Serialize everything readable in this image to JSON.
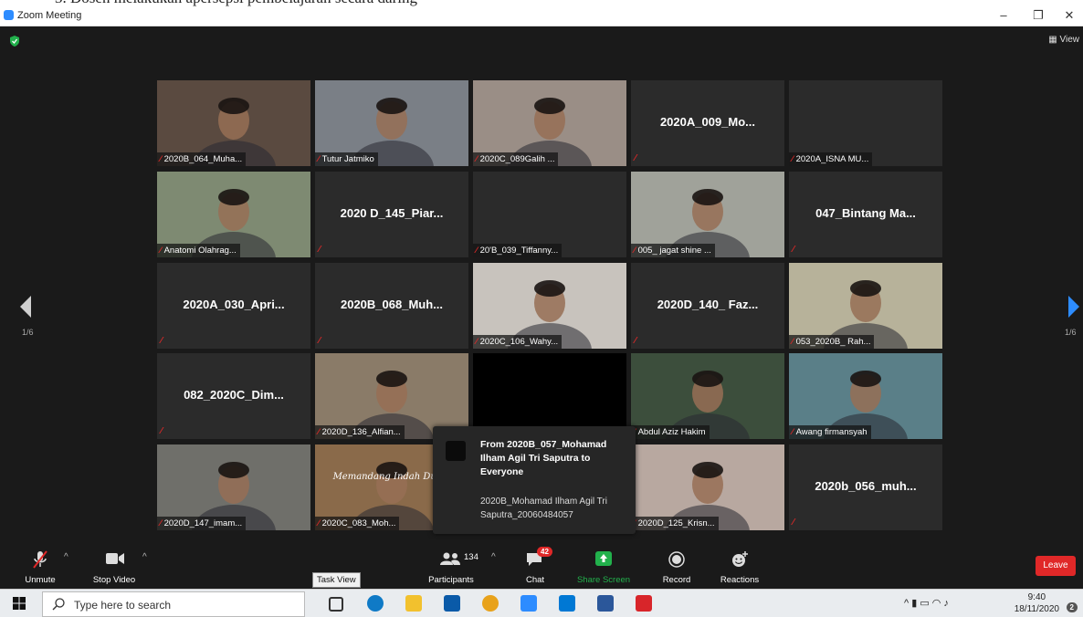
{
  "document_fragment": "3.   Dosen melakukan apersepsi pembelajaran secara daring",
  "window": {
    "title": "Zoom Meeting",
    "minimize": "–",
    "maximize": "❐",
    "close": "✕"
  },
  "view_label": "View",
  "page_indicator": {
    "left": "1/6",
    "right": "1/6"
  },
  "tiles": [
    {
      "name": "2020B_064_Muha...",
      "video": true,
      "bg": "#5a4a40"
    },
    {
      "name": "Tutur Jatmiko",
      "video": true,
      "bg": "#7a7f86"
    },
    {
      "name": "2020C_089Galih ...",
      "video": true,
      "bg": "#9a8e86"
    },
    {
      "name": "2020A_009_Mo...",
      "video": false
    },
    {
      "name": "2020A_ISNA MU...",
      "video": true,
      "bg": "#2b2b2b"
    },
    {
      "name": "Anatomi Olahrag...",
      "video": true,
      "bg": "#7e8a72"
    },
    {
      "name": "2020 D_145_Piar...",
      "video": false
    },
    {
      "name": "20'B_039_Tiffanny...",
      "video": true,
      "bg": "#2b2b2b"
    },
    {
      "name": "005_ jagat shine ...",
      "video": true,
      "bg": "#a0a29a"
    },
    {
      "name": "047_Bintang Ma...",
      "video": false
    },
    {
      "name": "2020A_030_Apri...",
      "video": false
    },
    {
      "name": "2020B_068_Muh...",
      "video": false
    },
    {
      "name": "2020C_106_Wahy...",
      "video": true,
      "bg": "#c8c3bd"
    },
    {
      "name": "2020D_140_ Faz...",
      "video": false
    },
    {
      "name": "053_2020B_ Rah...",
      "video": true,
      "bg": "#b7b29a"
    },
    {
      "name": "082_2020C_Dim...",
      "video": false
    },
    {
      "name": "2020D_136_Alfian...",
      "video": true,
      "bg": "#8a7b68"
    },
    {
      "name": "",
      "video": true,
      "bg": "#000000"
    },
    {
      "name": "Abdul Aziz Hakim",
      "video": true,
      "bg": "#3c4e3c"
    },
    {
      "name": "Awang firmansyah",
      "video": true,
      "bg": "#5a7f88"
    },
    {
      "name": "2020D_147_imam...",
      "video": true,
      "bg": "#6f6f6a"
    },
    {
      "name": "2020C_083_Moh...",
      "video": true,
      "bg": "#8a6a4a"
    },
    {
      "name": "",
      "video": true,
      "bg": "#2b2b2b"
    },
    {
      "name": "2020D_125_Krisn...",
      "video": true,
      "bg": "#b8a8a0"
    },
    {
      "name": "2020b_056_muh...",
      "video": false
    }
  ],
  "video_overlay_texts": {
    "caption_c083": "Memandang Indah Dunia"
  },
  "chat_toast": {
    "from": "From 2020B_057_Mohamad Ilham Agil Tri Saputra to Everyone",
    "message": "2020B_Mohamad Ilham Agil Tri Saputra_20060484057"
  },
  "toolbar": {
    "unmute": "Unmute",
    "stop_video": "Stop Video",
    "participants": "Participants",
    "participants_count": "134",
    "chat": "Chat",
    "chat_badge": "42",
    "share_screen": "Share Screen",
    "record": "Record",
    "reactions": "Reactions",
    "leave": "Leave"
  },
  "tooltip": "Task View",
  "taskbar": {
    "search_placeholder": "Type here to search",
    "time": "9:40",
    "date": "18/11/2020",
    "notif_count": "2"
  },
  "colors": {
    "accent": "#2d8cff",
    "leave": "#e02828",
    "share": "#22b14c",
    "muted": "#e02828"
  }
}
